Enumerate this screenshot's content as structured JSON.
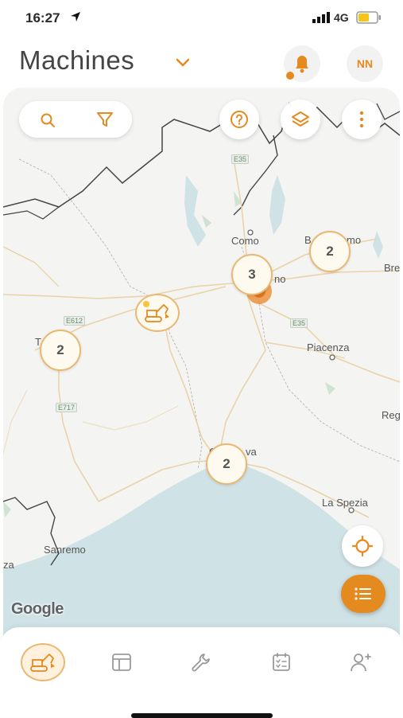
{
  "status_bar": {
    "time": "16:27",
    "network": "4G"
  },
  "header": {
    "title": "Machines",
    "avatar_initials": "NN"
  },
  "map": {
    "place_labels": [
      "Como",
      "Bergamo",
      "Milano",
      "Piacenza",
      "Brescia",
      "Reggio",
      "Genova",
      "La Spezia",
      "Sanremo",
      "Torino",
      "Nizza"
    ],
    "place_labels_visible": {
      "como": "Como",
      "bergamo": "B",
      "bergamo_tail": "mo",
      "milano_tail": "no",
      "piacenza": "Piacenza",
      "brescia": "Bre",
      "reggio": "Reg",
      "genova_tail": "va",
      "la_spezia": "La Spezia",
      "sanremo": "Sanremo",
      "torino": "T",
      "nizza": "za",
      "genova_head": "G"
    },
    "road_shields": [
      "E35",
      "E612",
      "E35",
      "E717"
    ],
    "clusters": [
      {
        "id": "cluster-bergamo",
        "count": "2"
      },
      {
        "id": "cluster-milano",
        "count": "3"
      },
      {
        "id": "cluster-torino",
        "count": "2"
      },
      {
        "id": "cluster-genova",
        "count": "2"
      }
    ],
    "attribution": "Google"
  },
  "icons": {
    "search": "search-icon",
    "filter": "filter-icon",
    "help": "help-icon",
    "layers": "layers-icon",
    "more": "more-vertical-icon",
    "locate": "crosshair-icon",
    "list": "list-icon",
    "bell": "bell-icon"
  },
  "bottom_nav": [
    "machines",
    "dashboard",
    "maintenance",
    "calendar",
    "add-user"
  ],
  "colors": {
    "accent": "#e58a1f",
    "accent_light": "#fff1dd",
    "sea": "#cfe2e6"
  }
}
